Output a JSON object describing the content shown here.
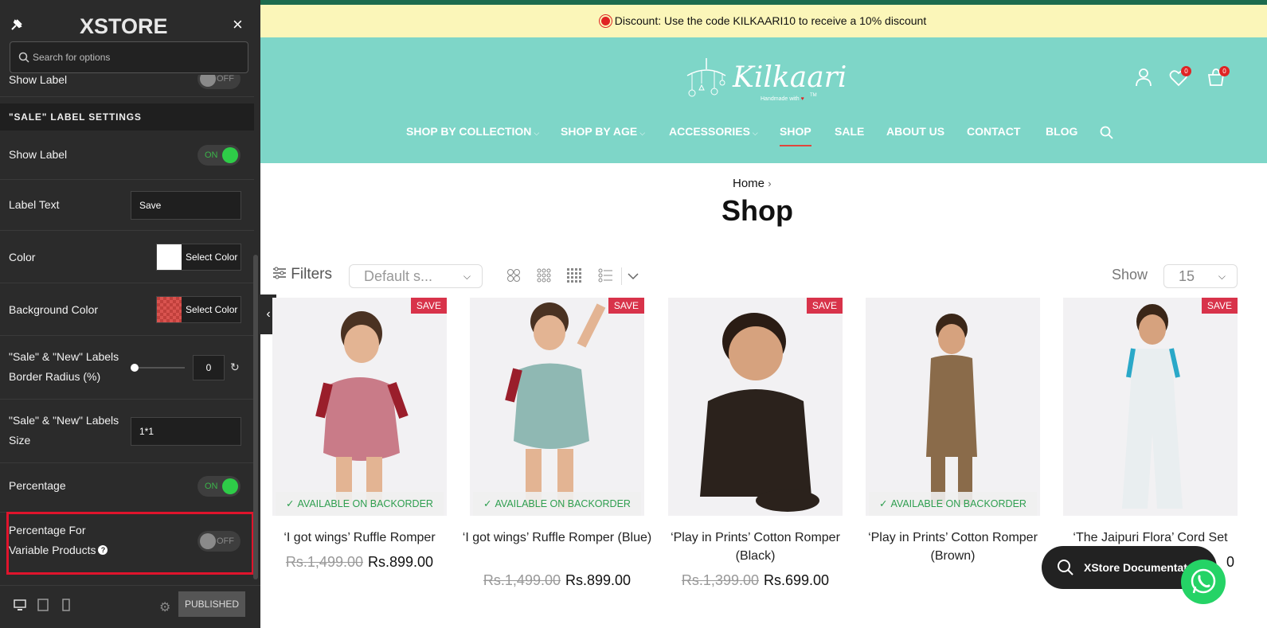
{
  "panel": {
    "logo": "XSTORE",
    "close_label": "×",
    "search": {
      "placeholder": "Search for options"
    },
    "partial_row_label": "Show Label",
    "partial_row_toggle": "OFF",
    "section_title": "\"SALE\" LABEL SETTINGS",
    "rows": {
      "show_label": {
        "label": "Show Label",
        "toggle": "ON"
      },
      "label_text": {
        "label": "Label Text",
        "value": "Save"
      },
      "color": {
        "label": "Color",
        "button": "Select Color",
        "swatch": "#ffffff"
      },
      "bg_color": {
        "label": "Background Color",
        "button": "Select Color",
        "swatch": "#d9534f"
      },
      "border_radius": {
        "label_line1": "\"Sale\" & \"New\" Labels",
        "label_line2": "Border Radius (%)",
        "value": "0"
      },
      "labels_size": {
        "label_line1": "\"Sale\" & \"New\" Labels",
        "label_line2": "Size",
        "value": "1*1"
      },
      "percentage": {
        "label": "Percentage",
        "toggle": "ON"
      },
      "percentage_variable": {
        "label_line1": "Percentage For",
        "label_line2": "Variable Products",
        "toggle": "OFF"
      }
    },
    "footer": {
      "publish_label": "PUBLISHED"
    }
  },
  "site": {
    "promo": "Discount: Use the code KILKAARI10 to receive a 10% discount",
    "brand": {
      "name": "Kilkaari",
      "sub": "Handmade with",
      "tm": "TM"
    },
    "wishlist_count": "0",
    "cart_count": "0",
    "nav": [
      {
        "label": "SHOP BY COLLECTION",
        "caret": "⌵"
      },
      {
        "label": "SHOP BY AGE",
        "caret": "⌵"
      },
      {
        "label": "ACCESSORIES",
        "caret": "⌵"
      },
      {
        "label": "SHOP",
        "caret": ""
      },
      {
        "label": "SALE",
        "caret": ""
      },
      {
        "label": "ABOUT US",
        "caret": ""
      },
      {
        "label": "CONTACT",
        "caret": ""
      },
      {
        "label": "BLOG",
        "caret": ""
      }
    ],
    "breadcrumb": "Home",
    "breadcrumb_sep": "›",
    "page_title": "Shop",
    "toolbar": {
      "filters": "Filters",
      "sort": "Default s...",
      "show_label": "Show",
      "show_value": "15"
    },
    "products": [
      {
        "badge": "SAVE",
        "backorder": "AVAILABLE ON BACKORDER",
        "title": "‘I got wings’ Ruffle Romper",
        "old_price": "Rs.1,499.00",
        "price": "Rs.899.00"
      },
      {
        "badge": "SAVE",
        "backorder": "AVAILABLE ON BACKORDER",
        "title": "‘I got wings’ Ruffle Romper (Blue)",
        "old_price": "Rs.1,499.00",
        "price": "Rs.899.00"
      },
      {
        "badge": "SAVE",
        "backorder": "",
        "title": "‘Play in Prints’ Cotton Romper (Black)",
        "old_price": "Rs.1,399.00",
        "price": "Rs.699.00"
      },
      {
        "badge": "",
        "backorder": "AVAILABLE ON BACKORDER",
        "title": "‘Play in Prints’ Cotton Romper (Brown)",
        "old_price": "",
        "price": ""
      },
      {
        "badge": "SAVE",
        "backorder": "",
        "title": "‘The Jaipuri Flora’ Cord Set",
        "old_price": "",
        "price": "0"
      }
    ],
    "docs_button": "XStore Documentat"
  }
}
